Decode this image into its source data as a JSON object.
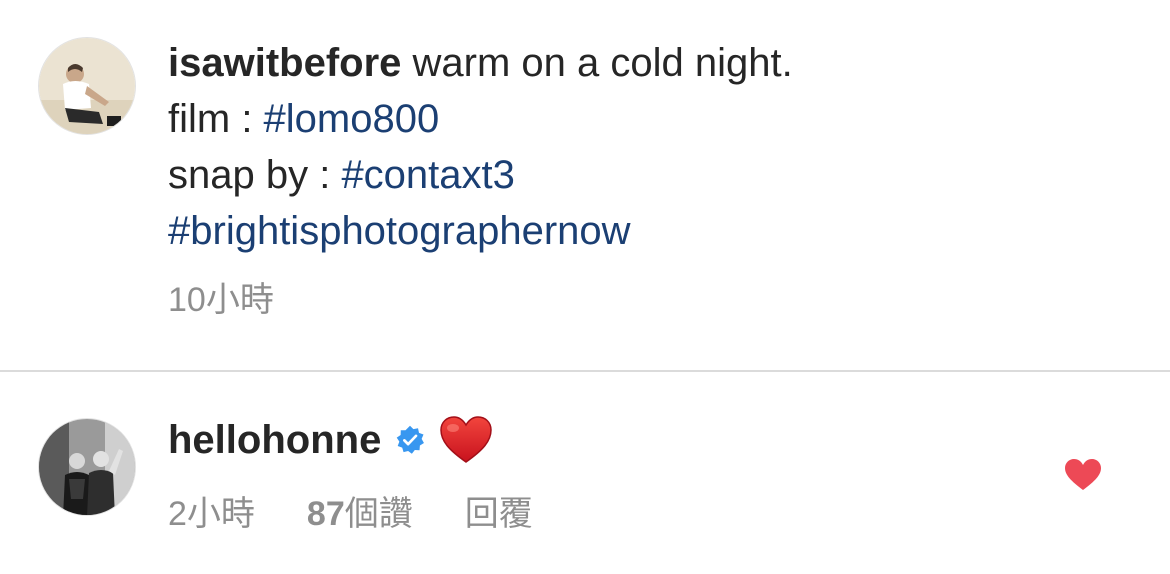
{
  "caption": {
    "username": "isawitbefore",
    "text": " warm on a cold night.",
    "film_label": "film : ",
    "film_tag": "#lomo800",
    "snap_label": "snap by : ",
    "snap_tag": "#contaxt3",
    "tag3": "#brightisphotographernow",
    "time": "10小時"
  },
  "comment": {
    "username": "hellohonne",
    "verified": true,
    "content_icon": "red-heart-emoji",
    "time": "2小時",
    "likes_count": "87",
    "likes_unit": "個讚",
    "reply_label": "回覆",
    "liked": true
  },
  "colors": {
    "text": "#262626",
    "hashtag": "#1b3f73",
    "muted": "#8e8e8e",
    "verified": "#3897f0",
    "heart": "#ed4956",
    "emoji_heart": "#e0202e"
  },
  "icons": {
    "caption_avatar": "profile-photo-icon",
    "comment_avatar": "profile-photo-icon",
    "verified": "verified-badge-icon",
    "like": "heart-filled-icon"
  }
}
